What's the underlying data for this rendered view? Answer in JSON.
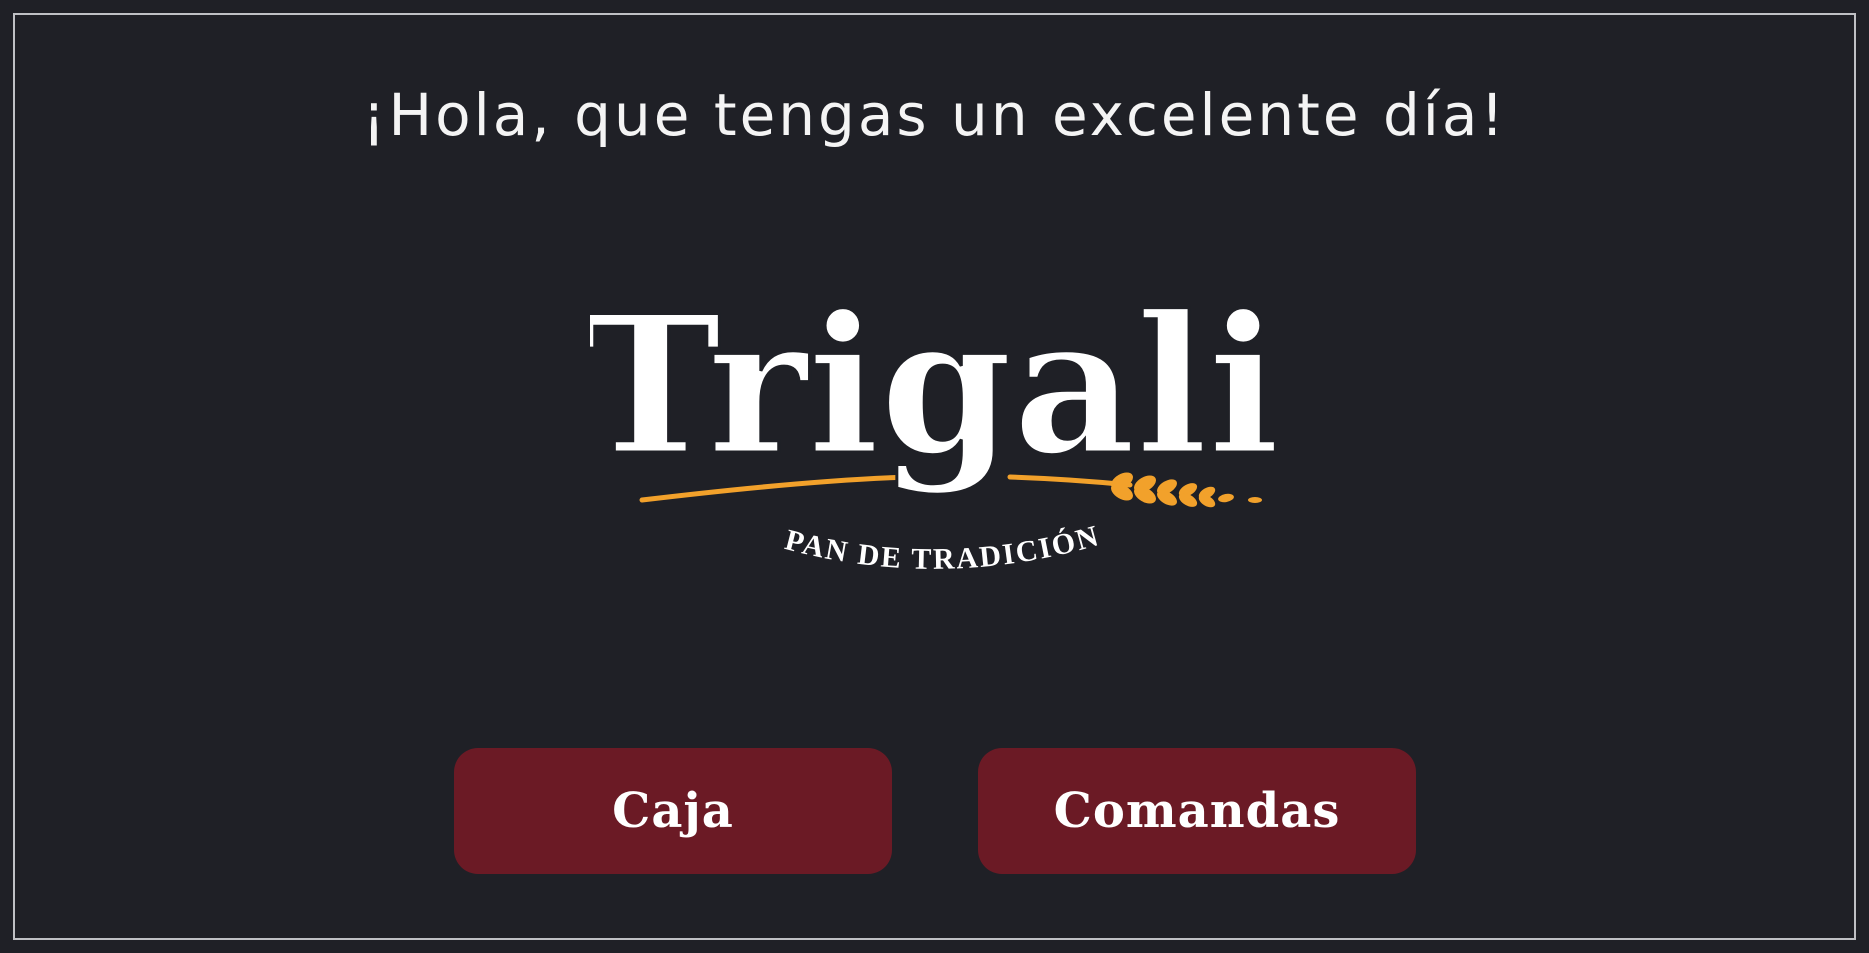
{
  "greeting": "¡Hola, que tengas un excelente día!",
  "logo": {
    "wordmark": "Trigali",
    "tagline": "PAN DE TRADICIÓN"
  },
  "buttons": {
    "caja": "Caja",
    "comandas": "Comandas"
  },
  "colors": {
    "background": "#1f2026",
    "frame": "#bfc0c4",
    "button": "#6b1a25",
    "wheat": "#f2a12b",
    "text": "#ffffff"
  }
}
